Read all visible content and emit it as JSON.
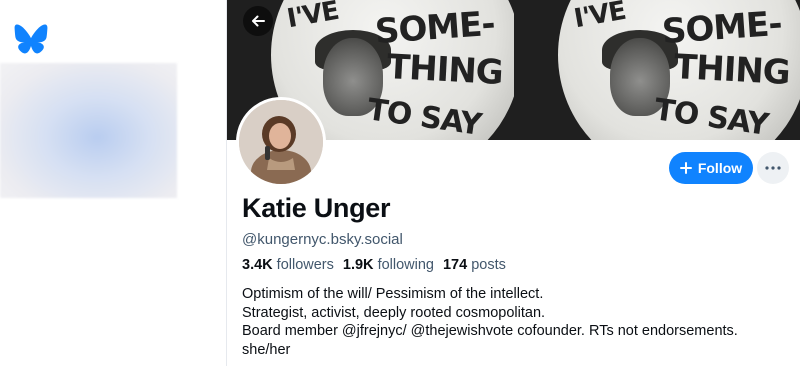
{
  "app": {
    "logo_icon": "butterfly-icon",
    "accent_color": "#1083fe"
  },
  "banner": {
    "button_lines": [
      "I'VE",
      "SOME-",
      "THING",
      "TO SAY"
    ]
  },
  "header": {
    "back_icon": "arrow-left-icon"
  },
  "actions": {
    "follow_label": "Follow",
    "follow_icon": "plus-icon",
    "more_icon": "ellipsis-icon"
  },
  "profile": {
    "display_name": "Katie Unger",
    "handle": "@kungernyc.bsky.social",
    "followers_count": "3.4K",
    "followers_label": "followers",
    "following_count": "1.9K",
    "following_label": "following",
    "posts_count": "174",
    "posts_label": "posts",
    "bio_lines": [
      "Optimism of the will/ Pessimism of the intellect.",
      "Strategist, activist, deeply rooted cosmopolitan.",
      "Board member @jfrejnyc/ @thejewishvote cofounder. RTs not endorsements.",
      "she/her"
    ]
  }
}
